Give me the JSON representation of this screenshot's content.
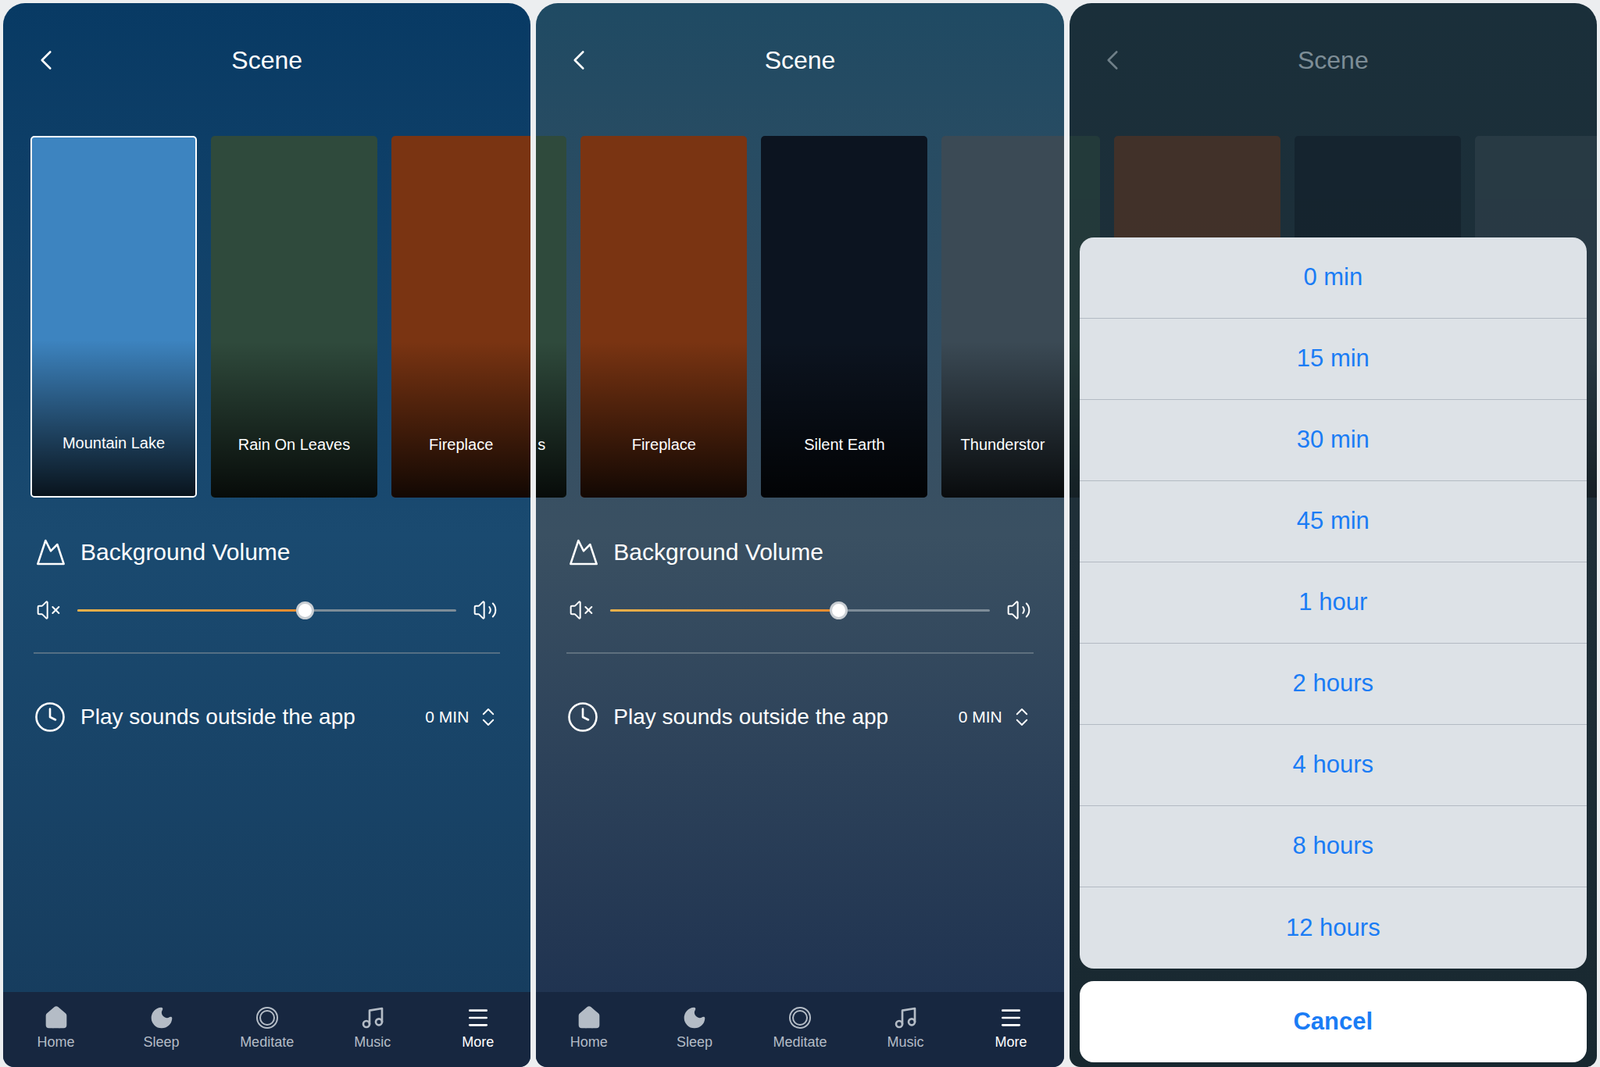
{
  "panels": [
    {
      "title": "Scene",
      "dimmed": false,
      "scenes": [
        {
          "name": "Mountain Lake",
          "selected": true,
          "kind": "full",
          "color": "#3d84c0"
        },
        {
          "name": "Rain On Leaves",
          "selected": false,
          "kind": "full",
          "color": "#2f4a3c"
        },
        {
          "name": "Fireplace",
          "selected": false,
          "kind": "cut-right",
          "color": "#7a3412"
        }
      ],
      "volume": {
        "label": "Background Volume",
        "level": 0.6
      },
      "timer": {
        "label": "Play sounds outside the app",
        "value": "0 MIN"
      },
      "tab_bar": [
        {
          "label": "Home",
          "selected": false
        },
        {
          "label": "Sleep",
          "selected": false
        },
        {
          "label": "Meditate",
          "selected": false
        },
        {
          "label": "Music",
          "selected": false
        },
        {
          "label": "More",
          "selected": true
        }
      ]
    },
    {
      "title": "Scene",
      "dimmed": false,
      "scenes": [
        {
          "name": "s",
          "selected": false,
          "kind": "cut-left",
          "color": "#2f4a3c"
        },
        {
          "name": "Fireplace",
          "selected": false,
          "kind": "full",
          "color": "#7a3412"
        },
        {
          "name": "Silent Earth",
          "selected": false,
          "kind": "full",
          "color": "#0c1420"
        },
        {
          "name": "Thunderstor",
          "selected": false,
          "kind": "cut-right",
          "color": "#3b4a55"
        }
      ],
      "volume": {
        "label": "Background Volume",
        "level": 0.6
      },
      "timer": {
        "label": "Play sounds outside the app",
        "value": "0 MIN"
      },
      "tab_bar": [
        {
          "label": "Home",
          "selected": false
        },
        {
          "label": "Sleep",
          "selected": false
        },
        {
          "label": "Meditate",
          "selected": false
        },
        {
          "label": "Music",
          "selected": false
        },
        {
          "label": "More",
          "selected": true
        }
      ]
    },
    {
      "title": "Scene",
      "dimmed": true,
      "scenes": [
        {
          "selected": false,
          "kind": "cut-left",
          "color": "#2f4a3c"
        },
        {
          "selected": false,
          "kind": "full",
          "color": "#7a3412"
        },
        {
          "selected": false,
          "kind": "full",
          "color": "#0c1420"
        },
        {
          "selected": false,
          "kind": "cut-right",
          "color": "#3b4a55"
        }
      ],
      "action_sheet": {
        "options": [
          "0 min",
          "15 min",
          "30 min",
          "45 min",
          "1 hour",
          "2 hours",
          "4 hours",
          "8 hours",
          "12 hours"
        ],
        "cancel": "Cancel"
      }
    }
  ]
}
